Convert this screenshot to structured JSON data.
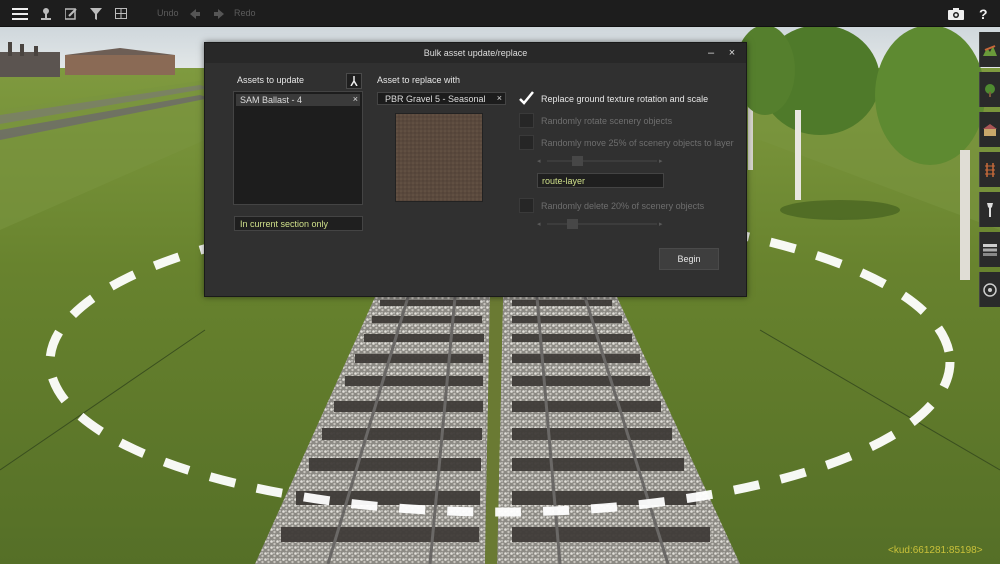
{
  "toolbar": {
    "undo_label": "Undo",
    "redo_label": "Redo",
    "icons": [
      "menu-icon",
      "person-icon",
      "edit-icon",
      "filter-icon",
      "grid-icon",
      "undo-arrow-icon",
      "redo-arrow-icon",
      "camera-icon"
    ]
  },
  "right_sidebar": {
    "icons": [
      "terrain-icon",
      "tree-icon",
      "building-icon",
      "track-icon",
      "wrench-icon",
      "layers-icon",
      "settings-icon"
    ]
  },
  "dialog": {
    "title": "Bulk asset update/replace",
    "minimize_label": "–",
    "close_label": "×",
    "assets_to_update_label": "Assets to update",
    "assets_to_update_items": [
      "SAM Ballast - 4"
    ],
    "remove_label": "×",
    "section_scope_value": "In current section only",
    "asset_to_replace_label": "Asset to replace with",
    "replacement_asset": "PBR Gravel 5 - Seasonal",
    "options": [
      {
        "label": "Replace ground texture rotation and scale",
        "checked": true,
        "enabled": true
      },
      {
        "label": "Randomly rotate scenery objects",
        "checked": false,
        "enabled": false
      },
      {
        "label": "Randomly move 25% of scenery objects to layer",
        "checked": false,
        "enabled": false
      },
      {
        "label": "Randomly delete 20% of scenery objects",
        "checked": false,
        "enabled": false
      }
    ],
    "move_percent_value": 25,
    "delete_percent_value": 20,
    "layer_value": "route-layer",
    "begin_label": "Begin"
  },
  "status": {
    "coords": "<kud:661281:85198>"
  },
  "colors": {
    "dialog_bg": "#303030",
    "field_text": "#cfe08a",
    "coords_text": "#c9c13a",
    "disabled_text": "#6e6e6e"
  }
}
